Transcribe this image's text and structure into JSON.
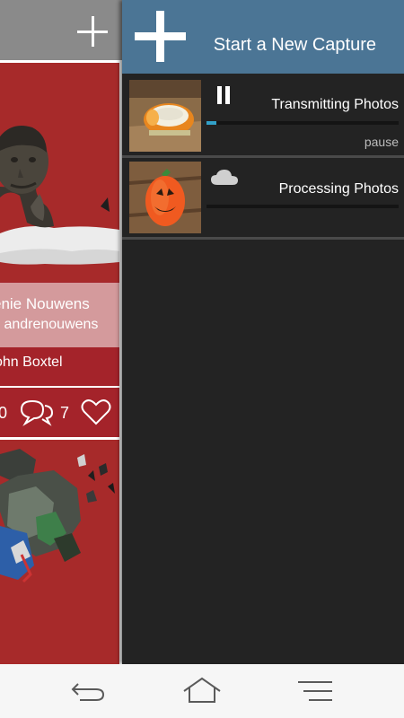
{
  "left_panel": {
    "card": {
      "title": "enie Nouwens",
      "byline": "y andrenouwens",
      "author": "ohn Boxtel",
      "comments_count": "0",
      "likes_count": "7"
    }
  },
  "drawer": {
    "header": {
      "title": "Start a New Capture"
    },
    "captures": [
      {
        "title": "Transmitting Photos",
        "status_icon": "pause-icon",
        "progress": 0.05,
        "action_label": "pause"
      },
      {
        "title": "Processing Photos",
        "status_icon": "cloud-icon",
        "progress": 0
      }
    ]
  },
  "nav": {
    "icons": [
      "back-icon",
      "home-icon",
      "menu-icon"
    ]
  },
  "colors": {
    "drawer_header": "#4b7595",
    "drawer_bg": "#232323",
    "card_red": "#a4232a",
    "card_info_pink": "#d49a9c",
    "progress": "#32a0c8"
  }
}
